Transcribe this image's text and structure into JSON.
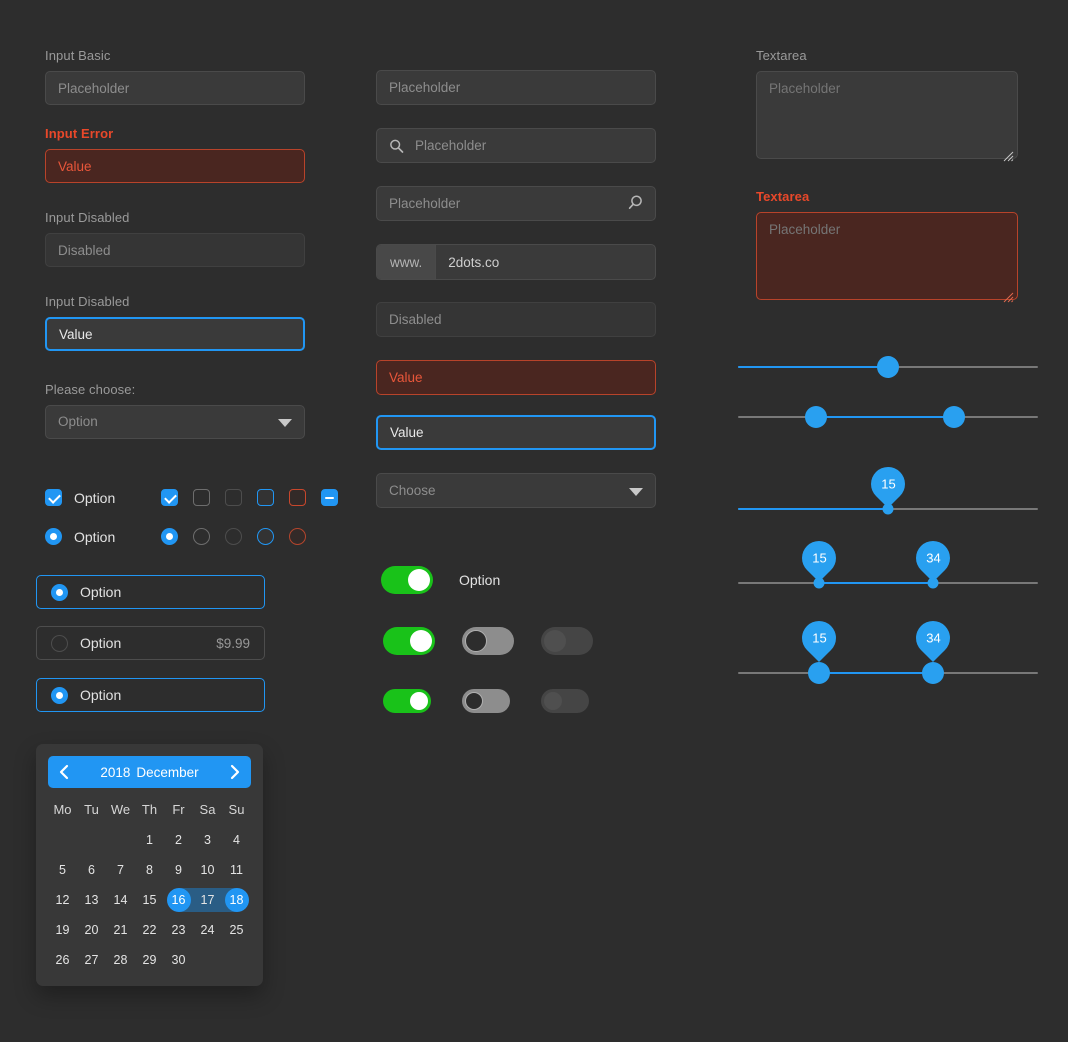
{
  "theme": {
    "background": "#2d2d2d",
    "accent": "#2196f3",
    "error": "#e8482a",
    "success": "#19c219",
    "field_bg": "#3a3a3a",
    "field_border": "#4a4a4a",
    "text": "#e2e2e2",
    "muted": "#8d8d8d"
  },
  "left_column": {
    "input_basic": {
      "label": "Input Basic",
      "placeholder": "Placeholder",
      "value": ""
    },
    "input_error": {
      "label": "Input Error",
      "value": "Value"
    },
    "input_disabled": {
      "label": "Input Disabled",
      "placeholder": "Disabled",
      "value": ""
    },
    "input_focus": {
      "label": "Input Disabled",
      "value": "Value"
    },
    "select": {
      "label": "Please choose:",
      "selected": "Option",
      "icon": "chevron-down-icon"
    },
    "checkbox_row": {
      "label": "Option",
      "states": [
        "checked",
        "unchecked",
        "unchecked-dim",
        "unchecked-blue",
        "unchecked-red",
        "indeterminate"
      ]
    },
    "radio_row": {
      "label": "Option",
      "states": [
        "checked",
        "unchecked",
        "unchecked-dim",
        "unchecked-blue",
        "unchecked-red"
      ]
    },
    "option_boxes": [
      {
        "label": "Option",
        "selected": true,
        "price": ""
      },
      {
        "label": "Option",
        "selected": false,
        "price": "$9.99"
      },
      {
        "label": "Option",
        "selected": true,
        "price": ""
      }
    ],
    "calendar": {
      "year": "2018",
      "month": "December",
      "prev_icon": "chevron-left-icon",
      "next_icon": "chevron-right-icon",
      "weekdays": [
        "Mo",
        "Tu",
        "We",
        "Th",
        "Fr",
        "Sa",
        "Su"
      ],
      "leading_blanks": 3,
      "days": [
        1,
        2,
        3,
        4,
        5,
        6,
        7,
        8,
        9,
        10,
        11,
        12,
        13,
        14,
        15,
        16,
        17,
        18,
        19,
        20,
        21,
        22,
        23,
        24,
        25,
        26,
        27,
        28,
        29,
        30
      ],
      "range_start": 16,
      "range_end": 18
    }
  },
  "middle_column": {
    "input_plain": {
      "placeholder": "Placeholder",
      "value": ""
    },
    "input_search_left": {
      "placeholder": "Placeholder",
      "value": "",
      "icon": "search-icon"
    },
    "input_search_right": {
      "placeholder": "Placeholder",
      "value": "",
      "icon": "search-icon"
    },
    "input_prefix": {
      "prefix": "www.",
      "value": "2dots.co"
    },
    "input_disabled": {
      "placeholder": "Disabled",
      "value": ""
    },
    "input_error": {
      "value": "Value"
    },
    "input_focus": {
      "value": "Value"
    },
    "select": {
      "selected": "Choose",
      "icon": "chevron-down-icon"
    },
    "toggle_labeled": {
      "label": "Option",
      "state": "on"
    },
    "toggle_row_1": [
      "on",
      "off",
      "disabled"
    ],
    "toggle_row_2": [
      "on",
      "off",
      "disabled"
    ]
  },
  "right_column": {
    "textarea": {
      "label": "Textarea",
      "placeholder": "Placeholder",
      "value": ""
    },
    "textarea_error": {
      "label": "Textarea",
      "placeholder": "Placeholder",
      "value": ""
    },
    "sliders": [
      {
        "type": "single",
        "value_pct": 50,
        "tooltip": null,
        "knob": "big"
      },
      {
        "type": "range",
        "low_pct": 26,
        "high_pct": 72,
        "tooltip": null,
        "knob": "big"
      },
      {
        "type": "single",
        "value_pct": 50,
        "tooltip": "15",
        "knob": "small"
      },
      {
        "type": "range",
        "low_pct": 27,
        "high_pct": 65,
        "tooltip_low": "15",
        "tooltip_high": "34",
        "knob": "small"
      },
      {
        "type": "range",
        "low_pct": 27,
        "high_pct": 65,
        "tooltip_low": "15",
        "tooltip_high": "34",
        "knob": "big"
      }
    ]
  }
}
